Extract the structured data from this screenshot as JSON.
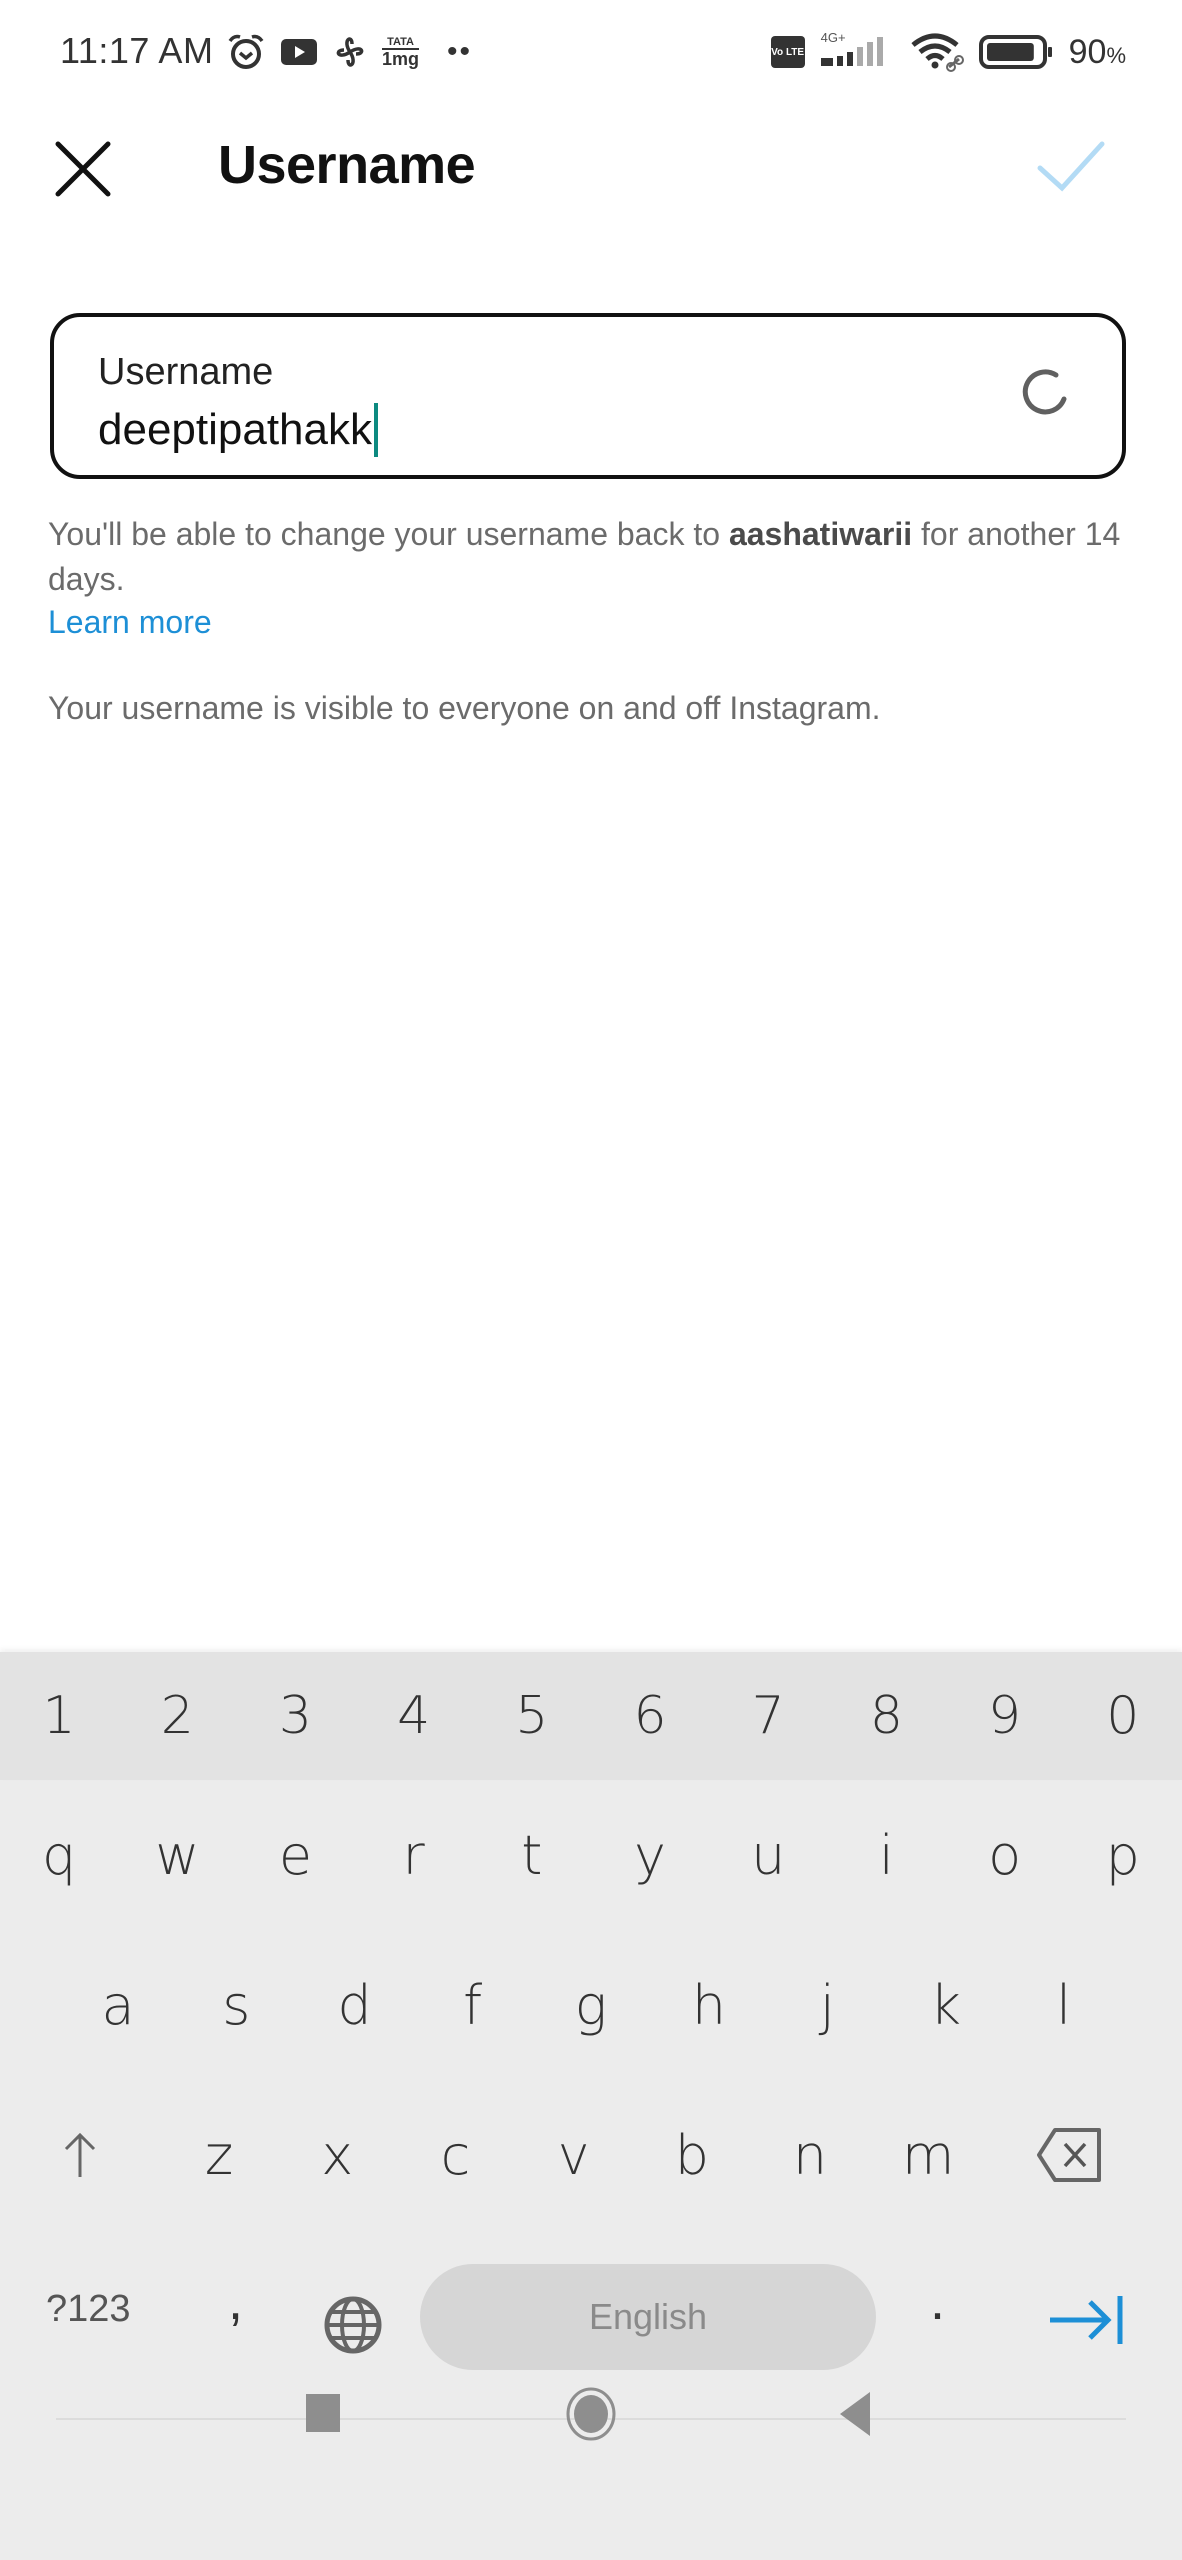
{
  "status_bar": {
    "time": "11:17 AM",
    "left_icons": [
      "alarm-icon",
      "youtube-icon",
      "pinwheel-app-icon",
      "tata-1mg-icon",
      "more-notifications-dots"
    ],
    "tata_label_top": "TATA",
    "tata_label_bottom": "1mg",
    "network_label": "4G+",
    "volte_label": "Vo LTE",
    "battery_percent": "90",
    "battery_unit": "%",
    "battery_level": 0.9
  },
  "app_bar": {
    "title": "Username",
    "close_icon": "close-icon",
    "done_icon": "checkmark-icon",
    "done_color": "#b3dbf5"
  },
  "username_field": {
    "label": "Username",
    "value": "deeptipathakk",
    "status": "loading",
    "caret_color": "#0d8a80"
  },
  "help": {
    "text_before": "You'll be able to change your username back to ",
    "old_username": "aashatiwarii",
    "text_after": " for another 14 days.",
    "learn_more": "Learn more",
    "visibility_note": "Your username is visible to everyone on and off Instagram.",
    "link_color": "#1d8fd6"
  },
  "keyboard": {
    "number_row": [
      "1",
      "2",
      "3",
      "4",
      "5",
      "6",
      "7",
      "8",
      "9",
      "0"
    ],
    "row1": [
      "q",
      "w",
      "e",
      "r",
      "t",
      "y",
      "u",
      "i",
      "o",
      "p"
    ],
    "row2": [
      "a",
      "s",
      "d",
      "f",
      "g",
      "h",
      "j",
      "k",
      "l"
    ],
    "row3": [
      "z",
      "x",
      "c",
      "v",
      "b",
      "n",
      "m"
    ],
    "symbols_key": "?123",
    "comma_key": ",",
    "period_key": ".",
    "space_label": "English",
    "shift_icon": "shift-arrow-icon",
    "backspace_icon": "backspace-icon",
    "globe_icon": "globe-icon",
    "next_icon": "next-field-arrow-icon",
    "next_color": "#1d8fd6"
  },
  "nav_bar": {
    "recent_icon": "recent-apps-square-icon",
    "home_icon": "home-circle-icon",
    "back_icon": "back-triangle-icon"
  }
}
